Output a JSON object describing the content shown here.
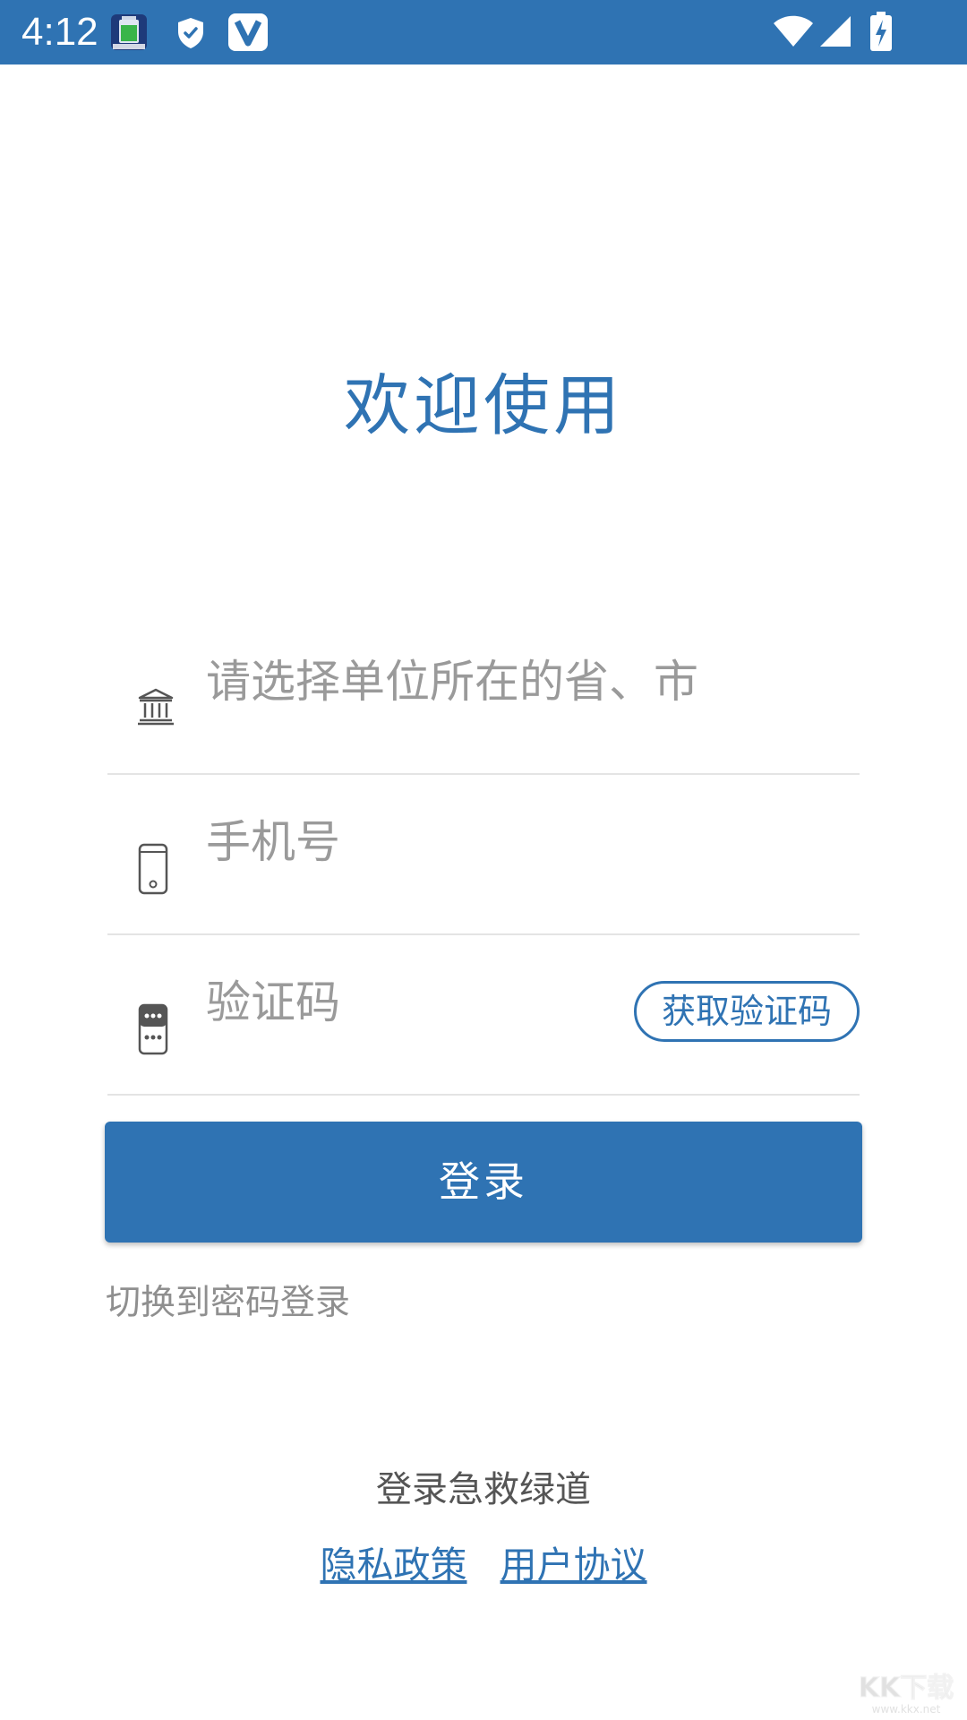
{
  "status_bar": {
    "time": "4:12",
    "bg_color": "#2f73b3",
    "icons": [
      "battery-app-icon",
      "shield-icon",
      "v-app-icon",
      "wifi-icon",
      "signal-icon",
      "battery-charging-icon"
    ]
  },
  "welcome": {
    "title": "欢迎使用"
  },
  "form": {
    "region": {
      "icon": "bank-building-icon",
      "placeholder": "请选择单位所在的省、市"
    },
    "phone": {
      "icon": "phone-icon",
      "placeholder": "手机号"
    },
    "code": {
      "icon": "sms-code-icon",
      "placeholder": "验证码",
      "get_code_label": "获取验证码"
    },
    "login_label": "登录",
    "switch_label": "切换到密码登录"
  },
  "footer": {
    "title": "登录急救绿道",
    "privacy_label": "隐私政策",
    "agreement_label": "用户协议"
  },
  "watermark": {
    "brand": "KK下载",
    "url": "www.kkx.net"
  },
  "colors": {
    "accent": "#2f73b3",
    "placeholder": "#9a9a9a",
    "divider": "#e4e4e4"
  }
}
